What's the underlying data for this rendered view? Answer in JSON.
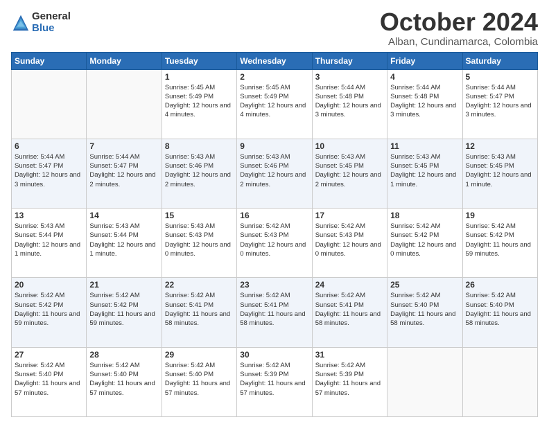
{
  "logo": {
    "general": "General",
    "blue": "Blue"
  },
  "title": "October 2024",
  "subtitle": "Alban, Cundinamarca, Colombia",
  "days_of_week": [
    "Sunday",
    "Monday",
    "Tuesday",
    "Wednesday",
    "Thursday",
    "Friday",
    "Saturday"
  ],
  "weeks": [
    [
      {
        "day": "",
        "info": ""
      },
      {
        "day": "",
        "info": ""
      },
      {
        "day": "1",
        "info": "Sunrise: 5:45 AM\nSunset: 5:49 PM\nDaylight: 12 hours and 4 minutes."
      },
      {
        "day": "2",
        "info": "Sunrise: 5:45 AM\nSunset: 5:49 PM\nDaylight: 12 hours and 4 minutes."
      },
      {
        "day": "3",
        "info": "Sunrise: 5:44 AM\nSunset: 5:48 PM\nDaylight: 12 hours and 3 minutes."
      },
      {
        "day": "4",
        "info": "Sunrise: 5:44 AM\nSunset: 5:48 PM\nDaylight: 12 hours and 3 minutes."
      },
      {
        "day": "5",
        "info": "Sunrise: 5:44 AM\nSunset: 5:47 PM\nDaylight: 12 hours and 3 minutes."
      }
    ],
    [
      {
        "day": "6",
        "info": "Sunrise: 5:44 AM\nSunset: 5:47 PM\nDaylight: 12 hours and 3 minutes."
      },
      {
        "day": "7",
        "info": "Sunrise: 5:44 AM\nSunset: 5:47 PM\nDaylight: 12 hours and 2 minutes."
      },
      {
        "day": "8",
        "info": "Sunrise: 5:43 AM\nSunset: 5:46 PM\nDaylight: 12 hours and 2 minutes."
      },
      {
        "day": "9",
        "info": "Sunrise: 5:43 AM\nSunset: 5:46 PM\nDaylight: 12 hours and 2 minutes."
      },
      {
        "day": "10",
        "info": "Sunrise: 5:43 AM\nSunset: 5:45 PM\nDaylight: 12 hours and 2 minutes."
      },
      {
        "day": "11",
        "info": "Sunrise: 5:43 AM\nSunset: 5:45 PM\nDaylight: 12 hours and 1 minute."
      },
      {
        "day": "12",
        "info": "Sunrise: 5:43 AM\nSunset: 5:45 PM\nDaylight: 12 hours and 1 minute."
      }
    ],
    [
      {
        "day": "13",
        "info": "Sunrise: 5:43 AM\nSunset: 5:44 PM\nDaylight: 12 hours and 1 minute."
      },
      {
        "day": "14",
        "info": "Sunrise: 5:43 AM\nSunset: 5:44 PM\nDaylight: 12 hours and 1 minute."
      },
      {
        "day": "15",
        "info": "Sunrise: 5:43 AM\nSunset: 5:43 PM\nDaylight: 12 hours and 0 minutes."
      },
      {
        "day": "16",
        "info": "Sunrise: 5:42 AM\nSunset: 5:43 PM\nDaylight: 12 hours and 0 minutes."
      },
      {
        "day": "17",
        "info": "Sunrise: 5:42 AM\nSunset: 5:43 PM\nDaylight: 12 hours and 0 minutes."
      },
      {
        "day": "18",
        "info": "Sunrise: 5:42 AM\nSunset: 5:42 PM\nDaylight: 12 hours and 0 minutes."
      },
      {
        "day": "19",
        "info": "Sunrise: 5:42 AM\nSunset: 5:42 PM\nDaylight: 11 hours and 59 minutes."
      }
    ],
    [
      {
        "day": "20",
        "info": "Sunrise: 5:42 AM\nSunset: 5:42 PM\nDaylight: 11 hours and 59 minutes."
      },
      {
        "day": "21",
        "info": "Sunrise: 5:42 AM\nSunset: 5:42 PM\nDaylight: 11 hours and 59 minutes."
      },
      {
        "day": "22",
        "info": "Sunrise: 5:42 AM\nSunset: 5:41 PM\nDaylight: 11 hours and 58 minutes."
      },
      {
        "day": "23",
        "info": "Sunrise: 5:42 AM\nSunset: 5:41 PM\nDaylight: 11 hours and 58 minutes."
      },
      {
        "day": "24",
        "info": "Sunrise: 5:42 AM\nSunset: 5:41 PM\nDaylight: 11 hours and 58 minutes."
      },
      {
        "day": "25",
        "info": "Sunrise: 5:42 AM\nSunset: 5:40 PM\nDaylight: 11 hours and 58 minutes."
      },
      {
        "day": "26",
        "info": "Sunrise: 5:42 AM\nSunset: 5:40 PM\nDaylight: 11 hours and 58 minutes."
      }
    ],
    [
      {
        "day": "27",
        "info": "Sunrise: 5:42 AM\nSunset: 5:40 PM\nDaylight: 11 hours and 57 minutes."
      },
      {
        "day": "28",
        "info": "Sunrise: 5:42 AM\nSunset: 5:40 PM\nDaylight: 11 hours and 57 minutes."
      },
      {
        "day": "29",
        "info": "Sunrise: 5:42 AM\nSunset: 5:40 PM\nDaylight: 11 hours and 57 minutes."
      },
      {
        "day": "30",
        "info": "Sunrise: 5:42 AM\nSunset: 5:39 PM\nDaylight: 11 hours and 57 minutes."
      },
      {
        "day": "31",
        "info": "Sunrise: 5:42 AM\nSunset: 5:39 PM\nDaylight: 11 hours and 57 minutes."
      },
      {
        "day": "",
        "info": ""
      },
      {
        "day": "",
        "info": ""
      }
    ]
  ]
}
